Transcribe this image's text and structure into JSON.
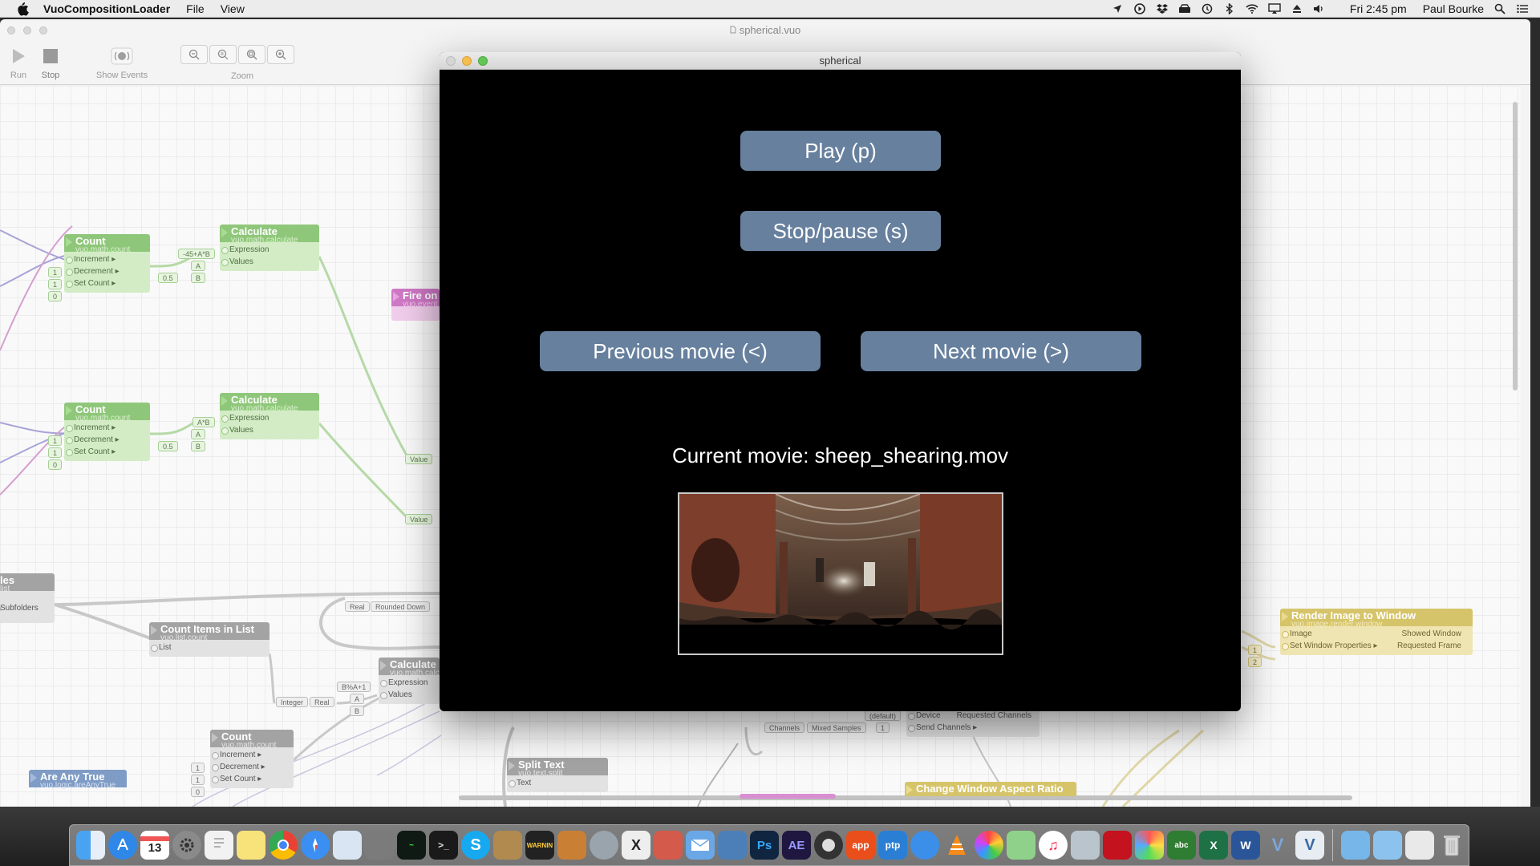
{
  "menubar": {
    "app_name": "VuoCompositionLoader",
    "menus": [
      "File",
      "View"
    ],
    "clock": "Fri 2:45 pm",
    "user": "Paul Bourke"
  },
  "editor": {
    "window_title": "spherical.vuo",
    "toolbar": {
      "run": "Run",
      "stop": "Stop",
      "show_events": "Show Events",
      "zoom": "Zoom"
    }
  },
  "nodes": {
    "count1": {
      "title": "Count",
      "class": "vuo.math.count",
      "ports": [
        "Increment ▸",
        "Decrement ▸",
        "Set Count ▸"
      ],
      "consts": [
        "1",
        "1",
        "0"
      ]
    },
    "calc1": {
      "title": "Calculate",
      "class": "vuo.math.calculate",
      "ports": [
        "Expression",
        "Values"
      ],
      "consts": [
        "-45+A*B",
        "A",
        "0.5",
        "B"
      ]
    },
    "count2": {
      "title": "Count",
      "class": "vuo.math.count",
      "ports": [
        "Increment ▸",
        "Decrement ▸",
        "Set Count ▸"
      ],
      "consts": [
        "1",
        "1",
        "0"
      ]
    },
    "calc2": {
      "title": "Calculate",
      "class": "vuo.math.calculate",
      "ports": [
        "Expression",
        "Values"
      ],
      "consts": [
        "A*B",
        "A",
        "0.5",
        "B"
      ]
    },
    "fire": {
      "title": "Fire on",
      "class": "vuo.event"
    },
    "files": {
      "title": "les",
      "class": "list",
      "port": "Subfolders"
    },
    "countitems": {
      "title": "Count Items in List",
      "class": "vuo.list.count",
      "port": "List"
    },
    "calc3": {
      "title": "Calculate",
      "class": "vuo.math.calc",
      "ports": [
        "Expression",
        "Values"
      ],
      "consts": [
        "B%A+1",
        "A",
        "B"
      ]
    },
    "count3": {
      "title": "Count",
      "class": "vuo.math.count",
      "ports": [
        "Increment ▸",
        "Decrement ▸",
        "Set Count ▸"
      ],
      "consts": [
        "1",
        "1",
        "0"
      ]
    },
    "anytrue": {
      "title": "Are Any True",
      "class": "vuo.logic.areAnyTrue"
    },
    "splittext": {
      "title": "Split Text",
      "class": "vuo.text.split",
      "port": "Text"
    },
    "render": {
      "title": "Render Image to Window",
      "class": "vuo.image.render.window",
      "ports_in": [
        "Image",
        "Set Window Properties ▸"
      ],
      "ports_out": [
        "Showed Window",
        "Requested Frame"
      ],
      "consts": [
        "1",
        "2"
      ]
    },
    "aspect": {
      "title": "Change Window Aspect Ratio"
    },
    "audio": {
      "ports": [
        "Device",
        "Send Channels ▸"
      ],
      "outs": [
        "Requested Channels"
      ],
      "consts": [
        "(default)",
        "1"
      ],
      "labels": [
        "Channels",
        "Mixed Samples"
      ]
    },
    "conv_labels": {
      "value1": "Value",
      "value2": "Value",
      "real": "Real",
      "rounded": "Rounded Down",
      "integer": "Integer",
      "real2": "Real"
    }
  },
  "movie_window": {
    "title": "spherical",
    "play": "Play (p)",
    "stop": "Stop/pause (s)",
    "prev": "Previous movie (<)",
    "next": "Next movie (>)",
    "current": "Current movie: sheep_shearing.mov"
  },
  "dock": {
    "apps": [
      "Finder",
      "App Store",
      "Calendar",
      "System Preferences",
      "TextEdit",
      "Notes",
      "Chrome",
      "Safari",
      "Preview",
      "Disk Utility",
      "Activity Monitor",
      "Terminal",
      "Skype",
      "Archive",
      "Console",
      "Sequel",
      "Network Radar",
      "Xcode",
      "Photo Booth",
      "Mail",
      "Preview2",
      "Photoshop",
      "After Effects",
      "Screen Capture",
      "App",
      "PTP",
      "Firefox",
      "VLC",
      "Photos",
      "Maps",
      "iTunes",
      "Remote Desktop",
      "Acrobat",
      "Pixelmator",
      "Spell",
      "Excel",
      "Word",
      "Vuo",
      "Vuo Loader",
      "Downloads",
      "Documents",
      "Google",
      "Trash"
    ],
    "calendar_day": "13",
    "warning_text": "WARNIN"
  },
  "colors": {
    "vuo_green": "#8fc77a",
    "vuo_grey": "#a3a3a3",
    "vuo_pink": "#cf78c6",
    "vuo_yellow": "#d6c46a",
    "button_blue": "#67809e"
  }
}
